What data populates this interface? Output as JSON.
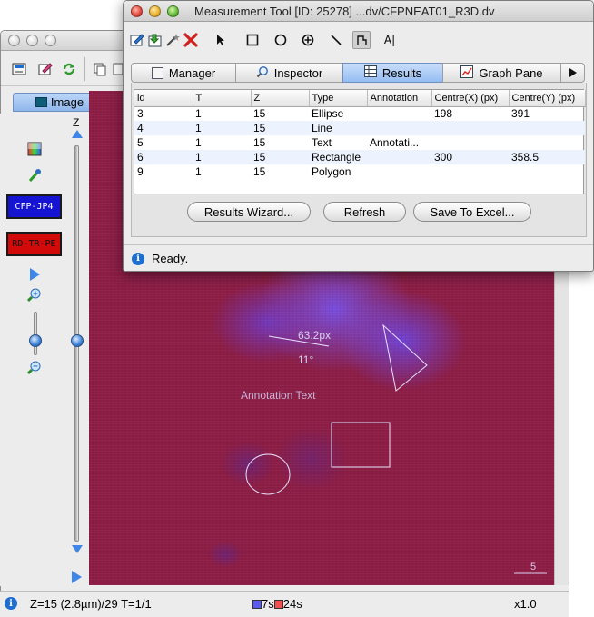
{
  "viewer": {
    "tab_label": "Image",
    "z_label": "Z",
    "channels": [
      {
        "label": "CFP-JP4",
        "bg": "#1414d2",
        "color": "#ffffff"
      },
      {
        "label": "RD-TR-PE",
        "bg": "#d20a0a",
        "color": "#111111"
      }
    ],
    "overlay": {
      "line_length": "63.2px",
      "angle": "11°",
      "annotation": "Annotation Text",
      "scalebar_label": "5"
    },
    "status": {
      "position": "Z=15 (2.8µm)/29 T=1/1",
      "channel_a_time": "7s",
      "channel_b_time": "24s",
      "zoom": "x1.0"
    }
  },
  "measurement_tool": {
    "title": "Measurement Tool [ID: 25278] ...dv/CFPNEAT01_R3D.dv",
    "tools": [
      "edit-icon",
      "save-roi-icon",
      "wand-icon",
      "delete-icon",
      "select-arrow-icon",
      "rectangle-icon",
      "ellipse-icon",
      "point-icon",
      "line-icon",
      "polyline-icon",
      "text-icon"
    ],
    "tabs": [
      {
        "label": "Manager",
        "icon": "manager-icon"
      },
      {
        "label": "Inspector",
        "icon": "magnifier-icon"
      },
      {
        "label": "Results",
        "icon": "results-icon",
        "active": true
      },
      {
        "label": "Graph Pane",
        "icon": "graph-icon"
      }
    ],
    "table": {
      "columns": [
        "id",
        "T",
        "Z",
        "Type",
        "Annotation",
        "Centre(X) (px)",
        "Centre(Y) (px)"
      ],
      "rows": [
        [
          "3",
          "1",
          "15",
          "Ellipse",
          "",
          "198",
          "391"
        ],
        [
          "4",
          "1",
          "15",
          "Line",
          "",
          "",
          ""
        ],
        [
          "5",
          "1",
          "15",
          "Text",
          "Annotati...",
          "",
          ""
        ],
        [
          "6",
          "1",
          "15",
          "Rectangle",
          "",
          "300",
          "358.5"
        ],
        [
          "9",
          "1",
          "15",
          "Polygon",
          "",
          "",
          ""
        ]
      ]
    },
    "buttons": {
      "wizard": "Results Wizard...",
      "refresh": "Refresh",
      "excel": "Save To Excel..."
    },
    "status": "Ready."
  }
}
